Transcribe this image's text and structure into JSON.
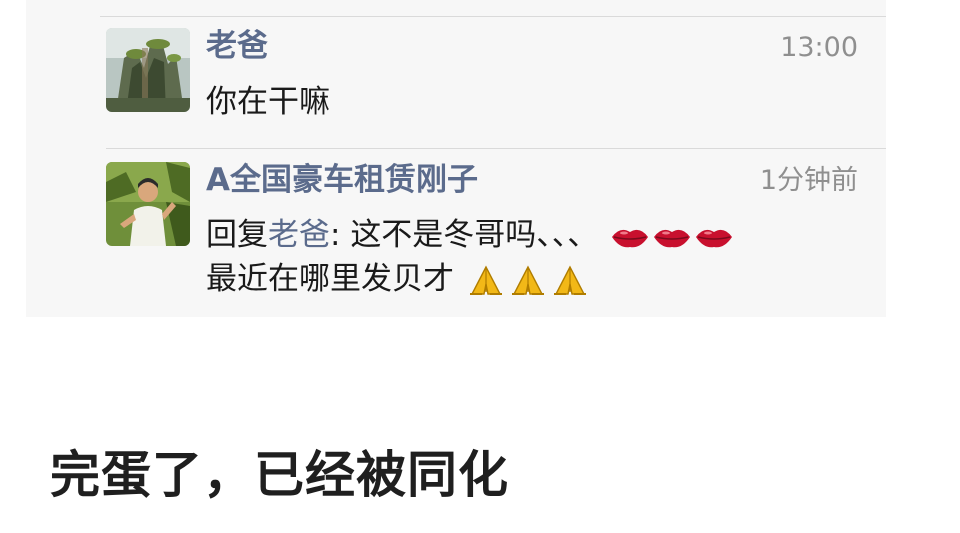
{
  "messages": [
    {
      "sender": "老爸",
      "time": "13:00",
      "text": "你在干嘛"
    },
    {
      "sender": "A全国豪车租赁刚子",
      "time": "1分钟前",
      "reply_prefix": "回复",
      "reply_to": "老爸",
      "reply_colon": ": ",
      "line1_text": "这不是冬哥吗、、、",
      "line1_emojis": [
        "lips-icon",
        "lips-icon",
        "lips-icon"
      ],
      "line2_text": "最近在哪里发贝才",
      "line2_emojis": [
        "praying-hands-icon",
        "praying-hands-icon",
        "praying-hands-icon"
      ]
    }
  ],
  "caption": "完蛋了，已经被同化",
  "colors": {
    "panel_bg": "#f7f7f7",
    "name": "#5b6b8c",
    "time": "#8f8f8f",
    "text": "#1a1a1a",
    "lips": "#c8102e",
    "hands": "#f2b817"
  }
}
